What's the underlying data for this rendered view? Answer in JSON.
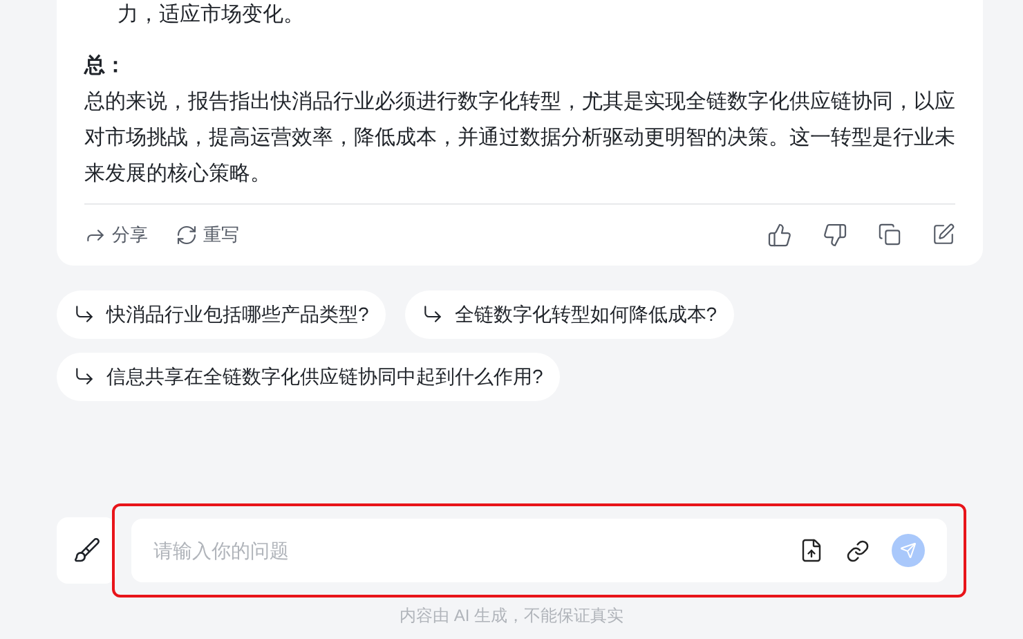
{
  "answer": {
    "previous_line": "力，适应市场变化。",
    "summary_heading": "总：",
    "summary": "总的来说，报告指出快消品行业必须进行数字化转型，尤其是实现全链数字化供应链协同，以应对市场挑战，提高运营效率，降低成本，并通过数据分析驱动更明智的决策。这一转型是行业未来发展的核心策略。",
    "actions": [
      "分享",
      "重写"
    ]
  },
  "suggestions": [
    "快消品行业包括哪些产品类型?",
    "全链数字化转型如何降低成本?",
    "信息共享在全链数字化供应链协同中起到什么作用?"
  ],
  "input": {
    "placeholder": "请输入你的问题"
  },
  "footer": "内容由 AI 生成，不能保证真实"
}
